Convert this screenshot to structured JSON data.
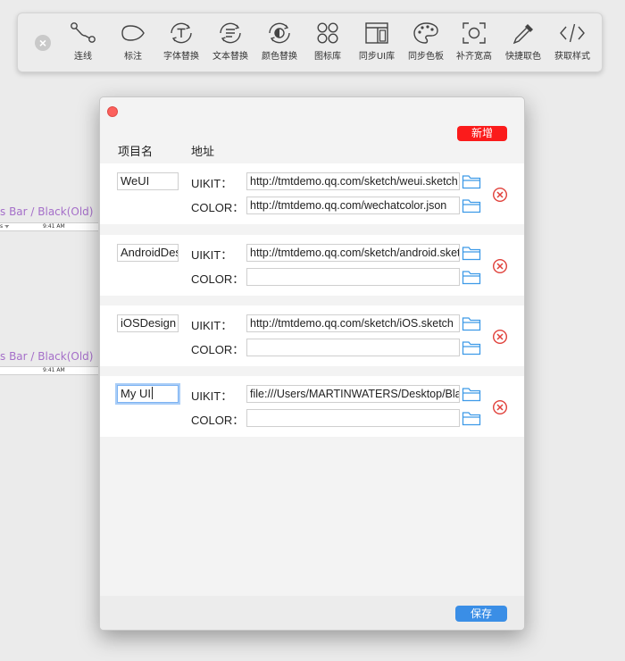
{
  "toolbar": {
    "close_glyph": "×",
    "tools": [
      {
        "label": "连线",
        "icon": "connect-icon"
      },
      {
        "label": "标注",
        "icon": "annotate-icon"
      },
      {
        "label": "字体替换",
        "icon": "font-replace-icon"
      },
      {
        "label": "文本替换",
        "icon": "text-replace-icon"
      },
      {
        "label": "颜色替换",
        "icon": "color-replace-icon"
      },
      {
        "label": "图标库",
        "icon": "icon-library-icon"
      },
      {
        "label": "同步UI库",
        "icon": "sync-ui-library-icon"
      },
      {
        "label": "同步色板",
        "icon": "sync-palette-icon"
      },
      {
        "label": "补齐宽高",
        "icon": "fill-size-icon"
      },
      {
        "label": "快捷取色",
        "icon": "eyedropper-icon"
      },
      {
        "label": "获取样式",
        "icon": "code-style-icon"
      }
    ]
  },
  "canvas": {
    "artboards": [
      {
        "label": "s Bar / Black(Old)",
        "bar_left": "s ᯤ",
        "time": "9:41 AM"
      },
      {
        "label": "s Bar / Black(Old)",
        "bar_left": "",
        "time": "9:41 AM"
      }
    ]
  },
  "dialog": {
    "header_name": "项目名",
    "header_address": "地址",
    "add_button": "新增",
    "save_button": "保存",
    "uikit_label": "UIKIT：",
    "color_label": "COLOR：",
    "projects": [
      {
        "name": "WeUI",
        "uikit": "http://tmtdemo.qq.com/sketch/weui.sketch",
        "color": "http://tmtdemo.qq.com/wechatcolor.json"
      },
      {
        "name": "AndroidDesign",
        "uikit": "http://tmtdemo.qq.com/sketch/android.sketch",
        "color": ""
      },
      {
        "name": "iOSDesign",
        "uikit": "http://tmtdemo.qq.com/sketch/iOS.sketch",
        "color": ""
      },
      {
        "name": "My UI",
        "uikit": "file:///Users/MARTINWATERS/Desktop/Black.sketch",
        "color": ""
      }
    ]
  },
  "colors": {
    "add_button": "#fb1b1b",
    "save_button": "#3a8ee6",
    "delete_icon": "#e0403a",
    "folder_icon": "#3d9ae8",
    "artboard_label": "#a56fc9"
  }
}
